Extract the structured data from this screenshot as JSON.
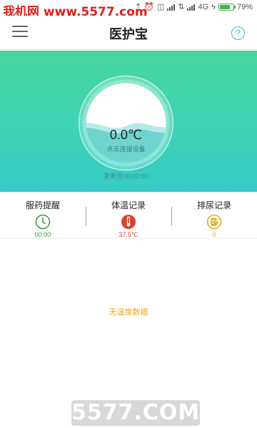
{
  "status_bar": {
    "watermark": "我机网 www.5577.com",
    "network": "4G",
    "battery_percent": "79%",
    "battery_level": 0.79
  },
  "header": {
    "title": "医护宝",
    "help_label": "?"
  },
  "monitor": {
    "temperature": "0.0℃",
    "connect_hint": "点击连接设备",
    "update_time": "更新至00:00:00"
  },
  "tabs": [
    {
      "label": "服药提醒",
      "value": "00:00",
      "icon": "clock-icon",
      "color": "#3a9a3a"
    },
    {
      "label": "体温记录",
      "value": "37.5℃",
      "icon": "thermometer-icon",
      "color": "#d9432a"
    },
    {
      "label": "排尿记录",
      "value": "0",
      "icon": "note-icon",
      "color": "#e6a817"
    }
  ],
  "empty_message": "无温度数据",
  "bottom_watermark": "5577.COM",
  "colors": {
    "accent": "#3ed3b3",
    "help": "#39b6c9",
    "empty": "#f0a21c"
  }
}
